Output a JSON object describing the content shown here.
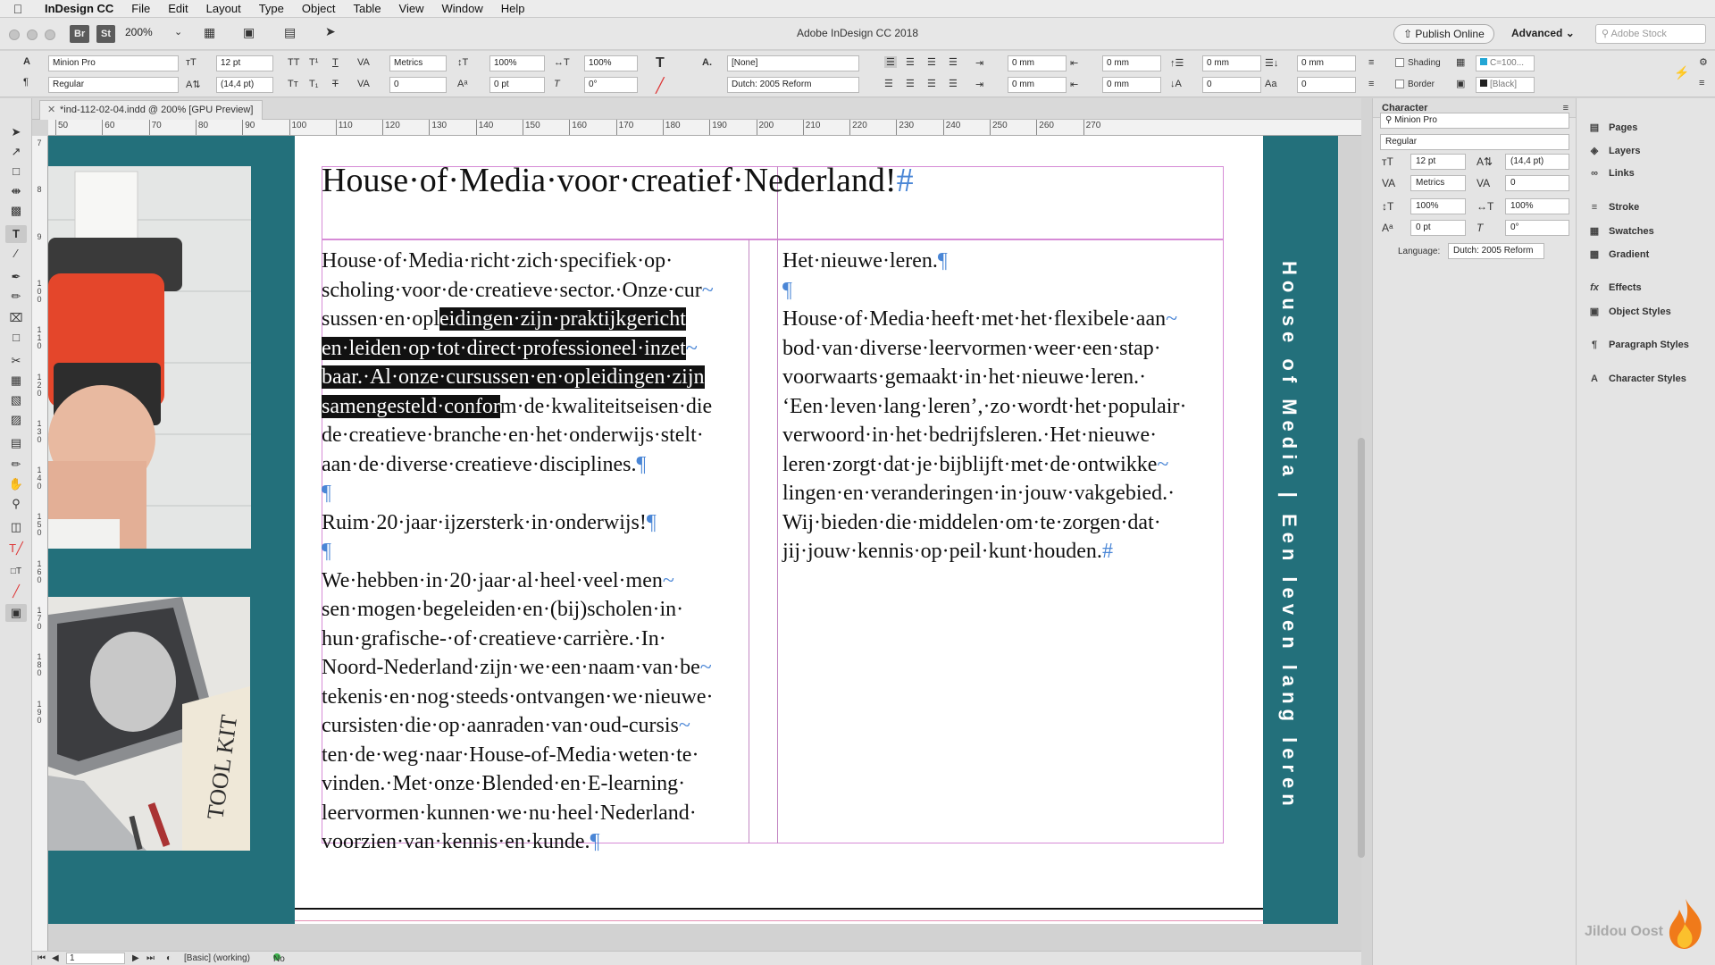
{
  "menubar": {
    "app_name": "InDesign CC",
    "items": [
      "File",
      "Edit",
      "Layout",
      "Type",
      "Object",
      "Table",
      "View",
      "Window",
      "Help"
    ]
  },
  "titlebar": {
    "bridge_chip": "Br",
    "stock_chip": "St",
    "zoom": "200%",
    "window_title": "Adobe InDesign CC 2018",
    "publish_label": "Publish Online",
    "workspace_label": "Advanced",
    "search_placeholder": "Adobe Stock"
  },
  "control": {
    "font_family": "Minion Pro",
    "font_style": "Regular",
    "font_size": "12 pt",
    "leading": "(14,4 pt)",
    "kerning": "Metrics",
    "tracking": "0",
    "vertical_scale": "100%",
    "horizontal_scale": "100%",
    "baseline_shift": "0 pt",
    "skew": "0°",
    "char_style": "[None]",
    "language": "Dutch: 2005 Reform",
    "indent_left": "0 mm",
    "indent_right": "0 mm",
    "first_line": "0 mm",
    "last_line": "0 mm",
    "space_before": "0 mm",
    "space_after": "0 mm",
    "drop_cap_lines": "0",
    "drop_cap_chars": "0",
    "shading_label": "Shading",
    "border_label": "Border",
    "shading_swatch": "C=100...",
    "border_swatch": "[Black]"
  },
  "tab": {
    "title": "*ind-112-02-04.indd @ 200% [GPU Preview]"
  },
  "ruler": {
    "h_ticks": [
      "50",
      "60",
      "70",
      "80",
      "90",
      "100",
      "110",
      "120",
      "130",
      "140",
      "150",
      "160",
      "170",
      "180",
      "190",
      "200",
      "210",
      "220",
      "230",
      "240",
      "250",
      "260",
      "270"
    ],
    "v_ticks": [
      "7",
      "8",
      "9",
      "100",
      "110",
      "120",
      "130",
      "140",
      "150",
      "160",
      "170",
      "180",
      "190"
    ]
  },
  "document": {
    "heading": "House·of·Media·voor·creatief·Nederland!",
    "heading_mark": "#",
    "col1_para1": {
      "line1": "House·of·Media·richt·zich·specifiek·op·",
      "line2": "scholing·voor·de·creatieve·sector.·Onze·cur",
      "line3_a": "sussen·en·opl",
      "line3_sel": "eidingen·zijn·praktijkgericht",
      "line4_sel": "en·leiden·op·tot·direct·professioneel·inzet",
      "line5_sel": "baar.·Al·onze·cursussen·en·opleidingen·zijn",
      "line6_sel": "samengesteld·confor",
      "line6_b": "m·de·kwaliteitseisen·die",
      "line7": "de·creatieve·branche·en·het·onderwijs·stelt·",
      "line8": "aan·de·diverse·creatieve·disciplines."
    },
    "col1_subheading": "Ruim·20·jaar·ijzersterk·in·onderwijs!",
    "col1_para2": [
      "We·hebben·in·20·jaar·al·heel·veel·men",
      "sen·mogen·begeleiden·en·(bij)scholen·in·",
      "hun·grafische-·of·creatieve·carrière.·In·",
      "Noord-Nederland·zijn·we·een·naam·van·be",
      "tekenis·en·nog·steeds·ontvangen·we·nieuwe·",
      "cursisten·die·op·aanraden·van·oud-cursis",
      "ten·de·weg·naar·House-of-Media·weten·te·",
      "vinden.·Met·onze·Blended·en·E-learning·",
      "leervormen·kunnen·we·nu·heel·Nederland·",
      "voorzien·van·kennis·en·kunde."
    ],
    "col2_heading": "Het·nieuwe·leren.",
    "col2_para": [
      "House·of·Media·heeft·met·het·flexibele·aan",
      "bod·van·diverse·leervormen·weer·een·stap·",
      "voorwaarts·gemaakt·in·het·nieuwe·leren.·",
      "‘Een·leven·lang·leren’,·zo·wordt·het·populair·",
      "verwoord·in·het·bedrijfsleren.·Het·nieuwe·",
      "leren·zorgt·dat·je·bijblijft·met·de·ontwikke",
      "lingen·en·veranderingen·in·jouw·vakgebied.·",
      "Wij·bieden·die·middelen·om·te·zorgen·dat·",
      "jij·jouw·kennis·op·peil·kunt·houden."
    ],
    "pilcrow": "¶",
    "hyphen_mark": "~",
    "end_mark": "#",
    "vertical_band_text": "House of Media | Een leven lang leren",
    "image2_caption": "TOOL KIT"
  },
  "status": {
    "page_number": "1",
    "preflight_profile": "[Basic] (working)",
    "errors": "No errors"
  },
  "character_panel": {
    "title": "Character",
    "font_family": "Minion Pro",
    "font_style": "Regular",
    "size": "12 pt",
    "leading": "(14,4 pt)",
    "kerning": "Metrics",
    "tracking": "0",
    "vertical_scale": "100%",
    "horizontal_scale": "100%",
    "baseline_shift": "0 pt",
    "skew": "0°",
    "language_label": "Language:",
    "language": "Dutch: 2005 Reform"
  },
  "dock": {
    "items": [
      "Pages",
      "Layers",
      "Links",
      "Stroke",
      "Swatches",
      "Gradient",
      "Effects",
      "Object Styles",
      "Paragraph Styles",
      "Character Styles"
    ]
  },
  "watermark": "Jildou Oost",
  "colors": {
    "teal": "#23707b",
    "frame": "#d68bd6",
    "pilcrow": "#4a86d6",
    "selection": "#111111"
  }
}
